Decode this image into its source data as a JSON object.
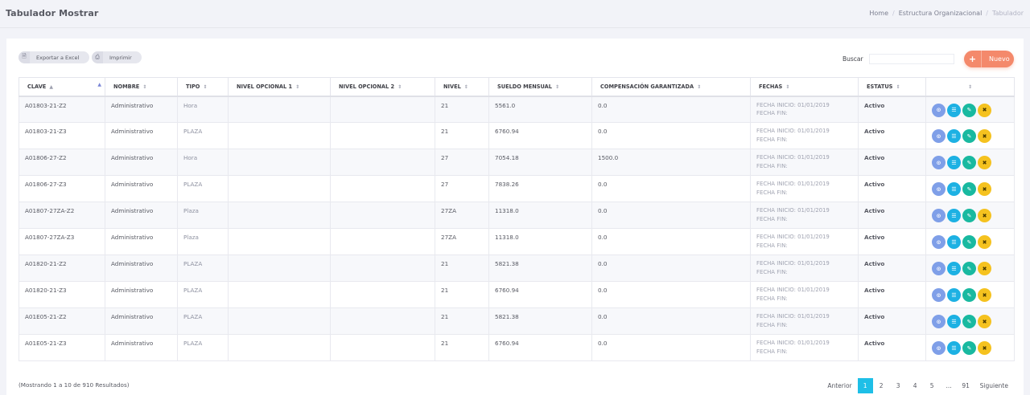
{
  "header": {
    "title": "Tabulador Mostrar",
    "breadcrumb": [
      "Home",
      "Estructura Organizacional",
      "Tabulador"
    ]
  },
  "toolbar": {
    "excel_label": "Exportar a Excel",
    "print_label": "Imprimir",
    "search_label": "Buscar",
    "search_value": "",
    "new_label": "Nuevo"
  },
  "table": {
    "columns": [
      "CLAVE",
      "NOMBRE",
      "TIPO",
      "NIVEL OPCIONAL 1",
      "NIVEL OPCIONAL 2",
      "NIVEL",
      "SUELDO MENSUAL",
      "COMPENSACIÓN GARANTIZADA",
      "FECHAS",
      "ESTATUS",
      ""
    ],
    "rows": [
      {
        "clave": "A01803-21-Z2",
        "nombre": "Administrativo",
        "tipo": "Hora",
        "op1": "",
        "op2": "",
        "nivel": "21",
        "sueldo": "5561.0",
        "comp": "0.0",
        "fecha_inicio": "FECHA INICIO: 01/01/2019",
        "fecha_fin": "FECHA FIN:",
        "estatus": "Activo"
      },
      {
        "clave": "A01803-21-Z3",
        "nombre": "Administrativo",
        "tipo": "PLAZA",
        "op1": "",
        "op2": "",
        "nivel": "21",
        "sueldo": "6760.94",
        "comp": "0.0",
        "fecha_inicio": "FECHA INICIO: 01/01/2019",
        "fecha_fin": "FECHA FIN:",
        "estatus": "Activo"
      },
      {
        "clave": "A01806-27-Z2",
        "nombre": "Administrativo",
        "tipo": "Hora",
        "op1": "",
        "op2": "",
        "nivel": "27",
        "sueldo": "7054.18",
        "comp": "1500.0",
        "fecha_inicio": "FECHA INICIO: 01/01/2019",
        "fecha_fin": "FECHA FIN:",
        "estatus": "Activo"
      },
      {
        "clave": "A01806-27-Z3",
        "nombre": "Administrativo",
        "tipo": "PLAZA",
        "op1": "",
        "op2": "",
        "nivel": "27",
        "sueldo": "7838.26",
        "comp": "0.0",
        "fecha_inicio": "FECHA INICIO: 01/01/2019",
        "fecha_fin": "FECHA FIN:",
        "estatus": "Activo"
      },
      {
        "clave": "A01807-27ZA-Z2",
        "nombre": "Administrativo",
        "tipo": "Plaza",
        "op1": "",
        "op2": "",
        "nivel": "27ZA",
        "sueldo": "11318.0",
        "comp": "0.0",
        "fecha_inicio": "FECHA INICIO: 01/01/2019",
        "fecha_fin": "FECHA FIN:",
        "estatus": "Activo"
      },
      {
        "clave": "A01807-27ZA-Z3",
        "nombre": "Administrativo",
        "tipo": "Plaza",
        "op1": "",
        "op2": "",
        "nivel": "27ZA",
        "sueldo": "11318.0",
        "comp": "0.0",
        "fecha_inicio": "FECHA INICIO: 01/01/2019",
        "fecha_fin": "FECHA FIN:",
        "estatus": "Activo"
      },
      {
        "clave": "A01820-21-Z2",
        "nombre": "Administrativo",
        "tipo": "PLAZA",
        "op1": "",
        "op2": "",
        "nivel": "21",
        "sueldo": "5821.38",
        "comp": "0.0",
        "fecha_inicio": "FECHA INICIO: 01/01/2019",
        "fecha_fin": "FECHA FIN:",
        "estatus": "Activo"
      },
      {
        "clave": "A01820-21-Z3",
        "nombre": "Administrativo",
        "tipo": "PLAZA",
        "op1": "",
        "op2": "",
        "nivel": "21",
        "sueldo": "6760.94",
        "comp": "0.0",
        "fecha_inicio": "FECHA INICIO: 01/01/2019",
        "fecha_fin": "FECHA FIN:",
        "estatus": "Activo"
      },
      {
        "clave": "A01E05-21-Z2",
        "nombre": "Administrativo",
        "tipo": "PLAZA",
        "op1": "",
        "op2": "",
        "nivel": "21",
        "sueldo": "5821.38",
        "comp": "0.0",
        "fecha_inicio": "FECHA INICIO: 01/01/2019",
        "fecha_fin": "FECHA FIN:",
        "estatus": "Activo"
      },
      {
        "clave": "A01E05-21-Z3",
        "nombre": "Administrativo",
        "tipo": "PLAZA",
        "op1": "",
        "op2": "",
        "nivel": "21",
        "sueldo": "6760.94",
        "comp": "0.0",
        "fecha_inicio": "FECHA INICIO: 01/01/2019",
        "fecha_fin": "FECHA FIN:",
        "estatus": "Activo"
      }
    ],
    "row_actions": [
      "info-icon",
      "document-icon",
      "edit-icon",
      "delete-icon"
    ]
  },
  "footer": {
    "results_text": "(Mostrando 1 a 10 de 910 Resultados)",
    "pagination": [
      "Anterior",
      "1",
      "2",
      "3",
      "4",
      "5",
      "...",
      "91",
      "Siguiente"
    ],
    "active_page": "1"
  },
  "colors": {
    "accent_new": "#f4896b",
    "pagination_active": "#1ebfe7",
    "action_info": "#7f9fe8",
    "action_doc": "#1db1e3",
    "action_edit": "#19b9a0",
    "action_delete": "#f5c21f"
  }
}
